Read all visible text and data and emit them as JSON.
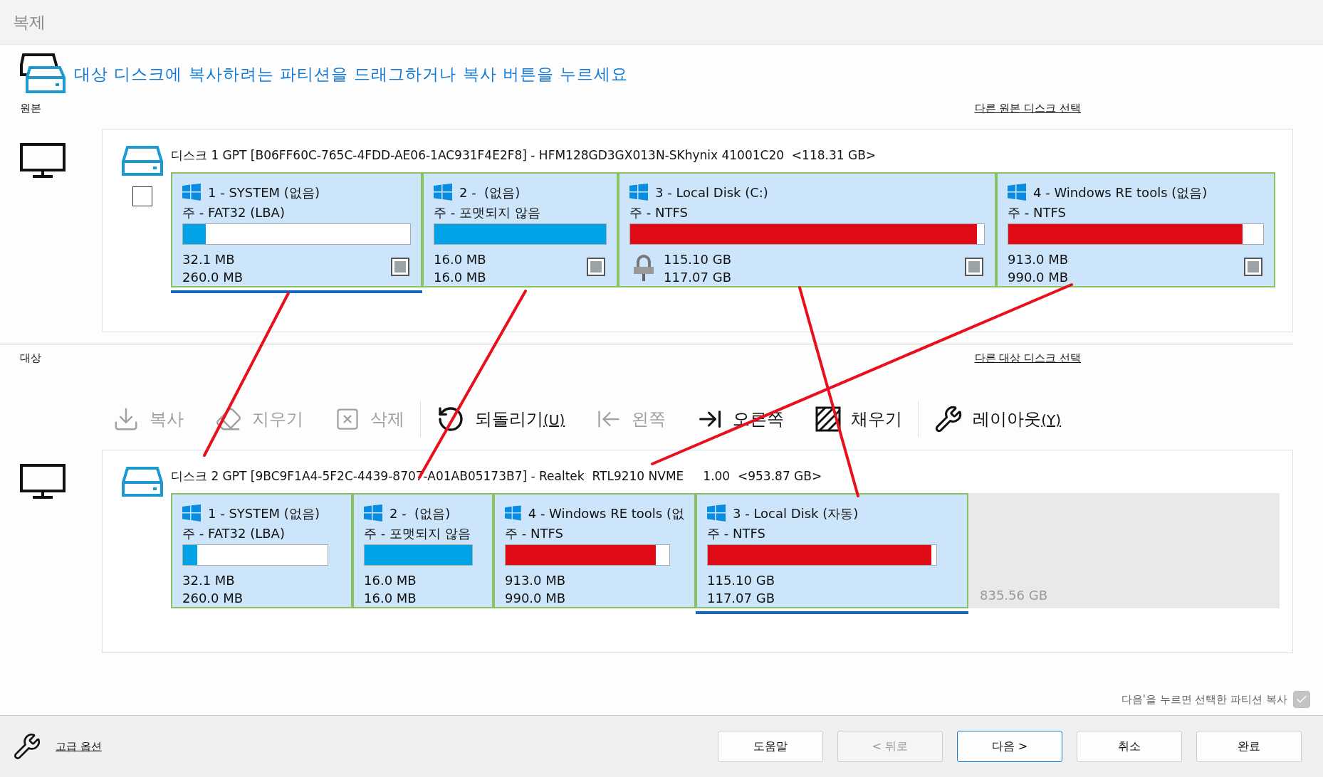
{
  "window": {
    "title": "복제"
  },
  "instruction": "대상 디스크에 복사하려는 파티션을 드래그하거나 복사 버튼을 누르세요",
  "source": {
    "label": "원본",
    "link": "다른 원본 디스크 선택",
    "checked": false,
    "disk": "디스크 1 GPT [B06FF60C-765C-4FDD-AE06-1AC931F4E2F8] - HFM128GD3GX013N-SKhynix 41001C20  <118.31 GB>",
    "partitions": [
      {
        "title": "1 - SYSTEM (없음)",
        "type": "주 - FAT32 (LBA)",
        "level": 0.1,
        "color": "#00a2e8",
        "used": "32.1 MB",
        "size": "260.0 MB",
        "checked": false,
        "selected": true,
        "locked": false
      },
      {
        "title": "2 -  (없음)",
        "type": "주 - 포맷되지 않음",
        "level": 1,
        "color": "#00a2e8",
        "used": "16.0 MB",
        "size": "16.0 MB",
        "checked": false,
        "selected": false,
        "locked": false
      },
      {
        "title": "3 - Local Disk (C:)",
        "type": "주 - NTFS",
        "level": 0.98,
        "color": "#e00b16",
        "used": "115.10 GB",
        "size": "117.07 GB",
        "checked": false,
        "selected": false,
        "locked": true
      },
      {
        "title": "4 - Windows RE tools (없음)",
        "type": "주 - NTFS",
        "level": 0.92,
        "color": "#e00b16",
        "used": "913.0 MB",
        "size": "990.0 MB",
        "checked": false,
        "selected": false,
        "locked": false
      }
    ]
  },
  "target": {
    "label": "대상",
    "link": "다른 대상 디스크 선택",
    "disk": "디스크 2 GPT [9BC9F1A4-5F2C-4439-8707-A01AB05173B7] - Realtek  RTL9210 NVME     1.00  <953.87 GB>",
    "partitions": [
      {
        "title": "1 - SYSTEM (없음)",
        "type": "주 - FAT32 (LBA)",
        "level": 0.1,
        "color": "#00a2e8",
        "used": "32.1 MB",
        "size": "260.0 MB",
        "selected": false
      },
      {
        "title": "2 -  (없음)",
        "type": "주 - 포맷되지 않음",
        "level": 1,
        "color": "#00a2e8",
        "used": "16.0 MB",
        "size": "16.0 MB",
        "selected": false
      },
      {
        "title": "4 - Windows RE tools (없",
        "type": "주 - NTFS",
        "level": 0.92,
        "color": "#e00b16",
        "used": "913.0 MB",
        "size": "990.0 MB",
        "selected": false
      },
      {
        "title": "3 - Local Disk (자동)",
        "type": "주 - NTFS",
        "level": 0.98,
        "color": "#e00b16",
        "used": "115.10 GB",
        "size": "117.07 GB",
        "selected": true
      }
    ],
    "unallocated": "835.56 GB"
  },
  "toolbar": [
    {
      "label": "복사",
      "disabled": true
    },
    {
      "label": "지우기",
      "disabled": true
    },
    {
      "label": "삭제",
      "disabled": true
    },
    {
      "label": "되돌리기",
      "accel": "(U)",
      "disabled": false
    },
    {
      "label": "왼쪽",
      "disabled": true
    },
    {
      "label": "오른쪽",
      "disabled": false
    },
    {
      "label": "채우기",
      "disabled": false
    },
    {
      "label": "레이아웃",
      "accel": "(Y)",
      "disabled": false
    }
  ],
  "copy_option": {
    "label": "다음'을 누르면 선택한 파티션 복사",
    "checked": true
  },
  "advanced_link": "고급 옵션",
  "buttons": [
    {
      "label": "도움말",
      "disabled": false,
      "default": false
    },
    {
      "label": "< 뒤로",
      "disabled": true,
      "default": false
    },
    {
      "label": "다음 >",
      "disabled": false,
      "default": true
    },
    {
      "label": "취소",
      "disabled": false,
      "default": false
    },
    {
      "label": "완료",
      "disabled": false,
      "default": false
    }
  ]
}
